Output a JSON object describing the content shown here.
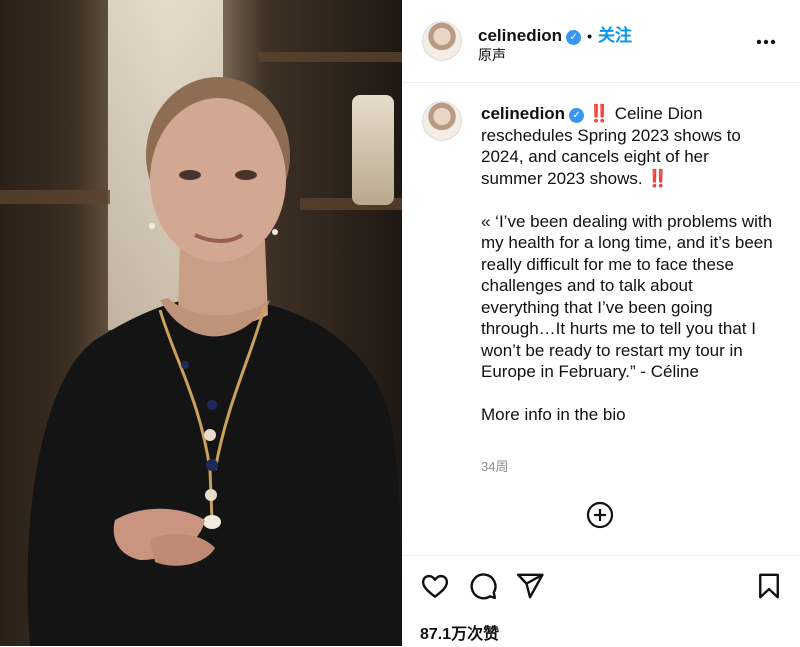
{
  "post": {
    "username": "celinedion",
    "verified_icon": "verified-badge-icon",
    "follow_label": "关注",
    "separator": "•",
    "audio_label": "原声",
    "more_label": "•••",
    "caption_user": "celinedion",
    "caption_text": " ‼️ Celine Dion reschedules Spring 2023 shows to 2024, and cancels eight of her summer 2023 shows. ‼️\n\n« ‘I’ve been dealing with problems with my health for a long time, and it’s been really difficult for me to face these challenges and to talk about everything that I’ve been going through…It hurts me to tell you that I won’t be ready to restart my tour in Europe in February.” - Céline\n\nMore info in the bio",
    "time_ago": "34周",
    "likes": "87.1万次赞"
  },
  "icons": {
    "like": "heart-icon",
    "comment": "comment-icon",
    "share": "paper-plane-icon",
    "save": "bookmark-icon",
    "add_comment": "plus-circle-icon"
  },
  "colors": {
    "accent": "#0095f6",
    "verified": "#3797f0",
    "muted": "#8e8e8e"
  }
}
